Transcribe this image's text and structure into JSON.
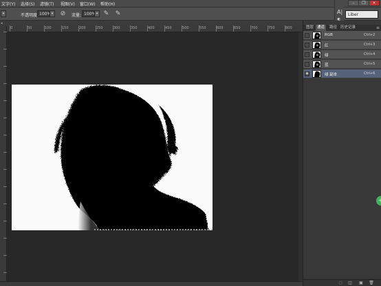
{
  "menubar": {
    "items": [
      "文字(Y)",
      "选择(S)",
      "滤镜(T)",
      "视图(V)",
      "窗口(W)",
      "帮助(H)"
    ]
  },
  "options": {
    "opacity_label": "不透明度:",
    "opacity_value": "100%",
    "flow_label": "流量:",
    "flow_value": "100%"
  },
  "ruler": {
    "marks": [
      "0",
      "50",
      "100",
      "150",
      "200",
      "250",
      "300",
      "350",
      "400",
      "450",
      "500",
      "550",
      "600",
      "650",
      "700",
      "750",
      "800"
    ]
  },
  "font_box": {
    "value": "Liber"
  },
  "panel": {
    "tabs": [
      "图层",
      "通道",
      "路径",
      "历史记录"
    ],
    "menu_glyph": "≡"
  },
  "channels": [
    {
      "name": "RGB",
      "shortcut": "Ctrl+2",
      "selected": false
    },
    {
      "name": "红",
      "shortcut": "Ctrl+3",
      "selected": false
    },
    {
      "name": "绿",
      "shortcut": "Ctrl+4",
      "selected": false
    },
    {
      "name": "蓝",
      "shortcut": "Ctrl+5",
      "selected": false
    },
    {
      "name": "绿 副本",
      "shortcut": "Ctrl+6",
      "selected": true
    }
  ],
  "icons": {
    "brush": "brush-icon",
    "airbrush": "airbrush-icon",
    "pressure": "pressure-icon",
    "mini_text": "text-tool-icon",
    "mini_para": "paragraph-icon",
    "eye": "eye-icon",
    "selection": "load-selection-icon",
    "mask": "save-selection-icon",
    "new": "new-channel-icon",
    "trash": "delete-channel-icon",
    "green": "plus-icon"
  },
  "colors": {
    "selected_row": "#56627a",
    "green_button": "#3fb35a"
  }
}
